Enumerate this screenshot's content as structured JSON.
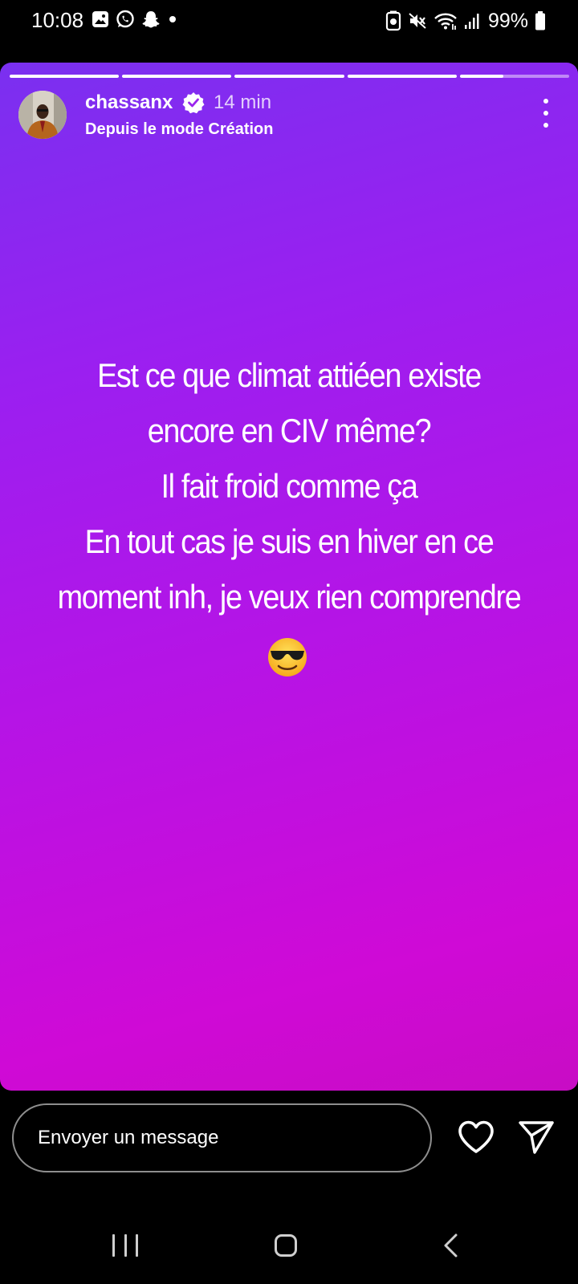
{
  "status_bar": {
    "time": "10:08",
    "battery": "99%",
    "left_icons": [
      "gallery-icon",
      "whatsapp-icon",
      "snapchat-icon",
      "dot-icon"
    ],
    "right_icons": [
      "data-saver-icon",
      "mute-icon",
      "wifi-icon",
      "signal-icon",
      "battery-icon"
    ]
  },
  "story": {
    "username": "chassanx",
    "time_ago": "14 min",
    "subtitle": "Depuis le mode Création",
    "progress": {
      "segments": 5,
      "current": 5,
      "current_fraction": 0.4
    },
    "text_lines": [
      "Est ce que climat attiéen existe",
      "encore en CIV même?",
      "Il fait froid comme ça",
      "En tout cas je suis en hiver en ce",
      "moment inh, je veux rien comprendre"
    ],
    "emoji": "😎",
    "gradient_colors": [
      "#7a30f0",
      "#b514e6",
      "#cf0ad6"
    ]
  },
  "reply": {
    "placeholder": "Envoyer un message",
    "like_icon": "heart-icon",
    "send_icon": "send-icon"
  },
  "nav": {
    "icons": [
      "recent-apps-icon",
      "home-icon",
      "back-icon"
    ]
  }
}
